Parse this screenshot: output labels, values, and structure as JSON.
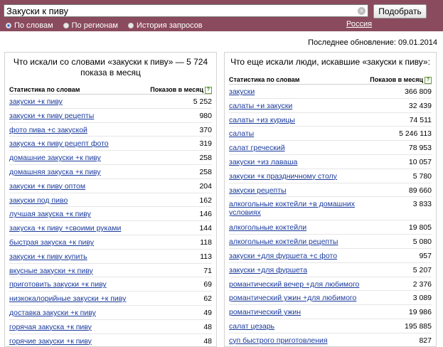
{
  "search": {
    "value": "Закуски к пиву",
    "button_label": "Подобрать"
  },
  "modes": [
    {
      "label": "По словам",
      "active": true
    },
    {
      "label": "По регионам",
      "active": false
    },
    {
      "label": "История запросов",
      "active": false
    }
  ],
  "region": "Россия",
  "last_updated": "Последнее обновление: 09.01.2014",
  "left_panel": {
    "title": "Что искали со словами «закуски к пиву» — 5 724 показа в месяц",
    "col_keyword": "Статистика по словам",
    "col_count": "Показов в месяц",
    "rows": [
      {
        "kw": "закуски +к пиву",
        "n": "5 252"
      },
      {
        "kw": "закуски +к пиву рецепты",
        "n": "980"
      },
      {
        "kw": "фото пива +с закуской",
        "n": "370"
      },
      {
        "kw": "закуска +к пиву рецепт фото",
        "n": "319"
      },
      {
        "kw": "домашние закуски +к пиву",
        "n": "258"
      },
      {
        "kw": "домашняя закуска +к пиву",
        "n": "258"
      },
      {
        "kw": "закуски +к пиву оптом",
        "n": "204"
      },
      {
        "kw": "закуски под пиво",
        "n": "162"
      },
      {
        "kw": "лучшая закуска +к пиву",
        "n": "146"
      },
      {
        "kw": "закуска +к пиву +своими руками",
        "n": "144"
      },
      {
        "kw": "быстрая закуска +к пиву",
        "n": "118"
      },
      {
        "kw": "закуски +к пиву купить",
        "n": "113"
      },
      {
        "kw": "вкусные закуски +к пиву",
        "n": "71"
      },
      {
        "kw": "приготовить закуски +к пиву",
        "n": "69"
      },
      {
        "kw": "низкокалорийные закуски +к пиву",
        "n": "62"
      },
      {
        "kw": "доставка закуски +к пиву",
        "n": "49"
      },
      {
        "kw": "горячая закуска +к пиву",
        "n": "48"
      },
      {
        "kw": "горячие закуски +к пиву",
        "n": "48"
      }
    ]
  },
  "right_panel": {
    "title": "Что еще искали люди, искавшие «закуски к пиву»:",
    "col_keyword": "Статистика по словам",
    "col_count": "Показов в месяц",
    "rows": [
      {
        "kw": "закуски",
        "n": "366 809"
      },
      {
        "kw": "салаты +и закуски",
        "n": "32 439"
      },
      {
        "kw": "салаты +из курицы",
        "n": "74 511"
      },
      {
        "kw": "салаты",
        "n": "5 246 113"
      },
      {
        "kw": "салат греческий",
        "n": "78 953"
      },
      {
        "kw": "закуски +из лаваша",
        "n": "10 057"
      },
      {
        "kw": "закуски +к праздничному столу",
        "n": "5 780"
      },
      {
        "kw": "закуски рецепты",
        "n": "89 660"
      },
      {
        "kw": "алкогольные коктейли +в домашних условиях",
        "n": "3 833",
        "tall": true
      },
      {
        "kw": "алкогольные коктейли",
        "n": "19 805"
      },
      {
        "kw": "алкогольные коктейли рецепты",
        "n": "5 080"
      },
      {
        "kw": "закуски +для фуршета +с фото",
        "n": "957"
      },
      {
        "kw": "закуски +для фуршета",
        "n": "5 207"
      },
      {
        "kw": "романтический вечер +для любимого",
        "n": "2 376"
      },
      {
        "kw": "романтический ужин +для любимого",
        "n": "3 089"
      },
      {
        "kw": "романтический ужин",
        "n": "19 986"
      },
      {
        "kw": "салат цезарь",
        "n": "195 885"
      },
      {
        "kw": "суп быстрого приготовления",
        "n": "827"
      }
    ]
  }
}
